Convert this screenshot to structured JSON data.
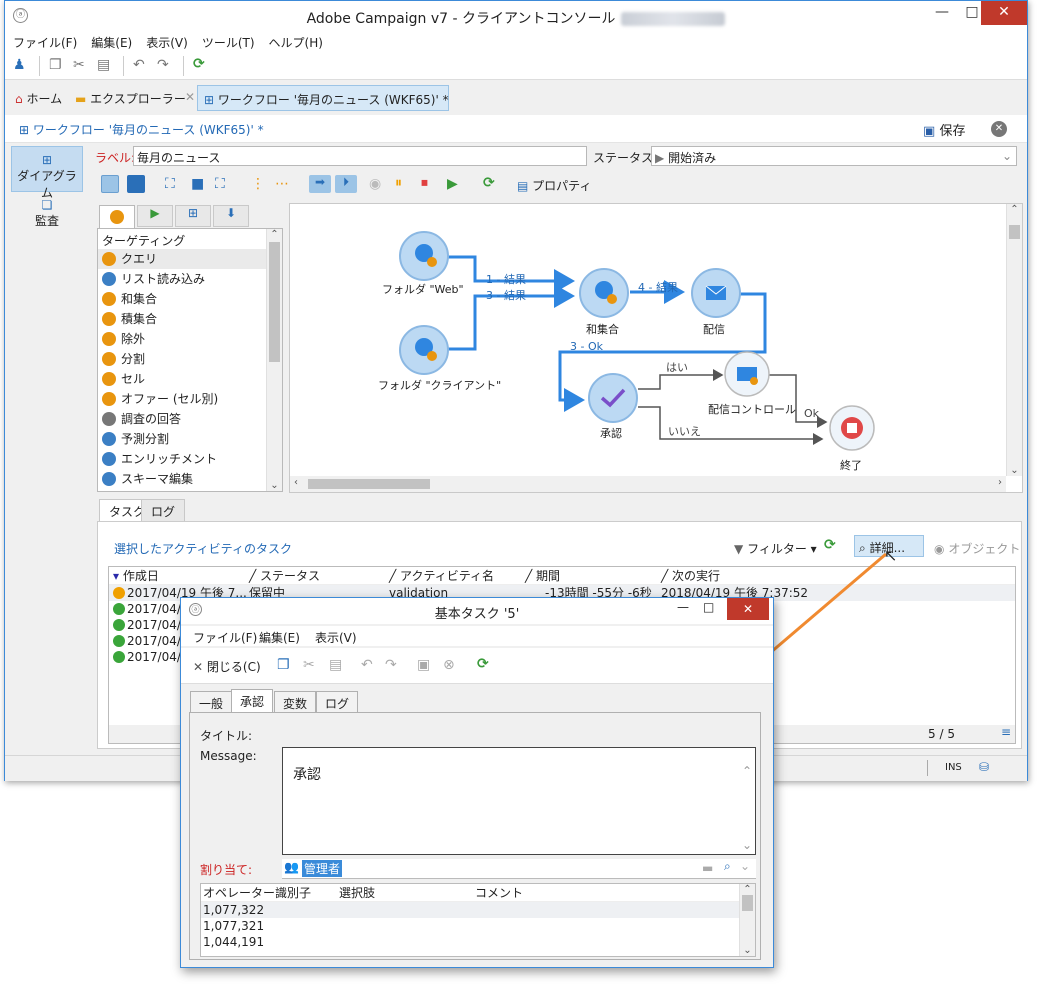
{
  "window": {
    "title": "Adobe Campaign v7 - クライアントコンソール",
    "blurred_user_label": "[admin@New]",
    "controls": {
      "minimize": "—",
      "maximize": "□",
      "close": "✕"
    }
  },
  "menu": [
    "ファイル(F)",
    "編集(E)",
    "表示(V)",
    "ツール(T)",
    "ヘルプ(H)"
  ],
  "tabs": {
    "home": "ホーム",
    "explorer": "エクスプローラー",
    "workflow": "ワークフロー '毎月のニュース (WKF65)'  *"
  },
  "subheader": {
    "breadcrumb": "ワークフロー '毎月のニュース (WKF65)' *",
    "save": "保存"
  },
  "sidebar": {
    "diagram": "ダイアグラム",
    "audit": "監査"
  },
  "form": {
    "label_caption": "ラベル:",
    "label_value": "毎月のニュース",
    "status_caption": "ステータス:",
    "status_value": "開始済み"
  },
  "canvas_toolbar": {
    "properties": "プロパティ"
  },
  "palette": {
    "header": "ターゲティング",
    "items": [
      {
        "label": "クエリ",
        "icon": "query-icon",
        "color": "#e8950f"
      },
      {
        "label": "リスト読み込み",
        "icon": "list-load-icon",
        "color": "#3b7fc4"
      },
      {
        "label": "和集合",
        "icon": "union-icon",
        "color": "#e8950f"
      },
      {
        "label": "積集合",
        "icon": "intersection-icon",
        "color": "#e8950f"
      },
      {
        "label": "除外",
        "icon": "exclusion-icon",
        "color": "#e8950f"
      },
      {
        "label": "分割",
        "icon": "split-icon",
        "color": "#e8950f"
      },
      {
        "label": "セル",
        "icon": "cell-icon",
        "color": "#e8950f"
      },
      {
        "label": "オファー (セル別)",
        "icon": "offer-icon",
        "color": "#e8950f"
      },
      {
        "label": "調査の回答",
        "icon": "survey-icon",
        "color": "#777777"
      },
      {
        "label": "予測分割",
        "icon": "prediction-icon",
        "color": "#3b7fc4"
      },
      {
        "label": "エンリッチメント",
        "icon": "enrichment-icon",
        "color": "#3b7fc4"
      },
      {
        "label": "スキーマ編集",
        "icon": "schema-icon",
        "color": "#3b7fc4"
      }
    ]
  },
  "workflow": {
    "nodes": {
      "folder_web": "フォルダ \"Web\"",
      "folder_client": "フォルダ \"クライアント\"",
      "union": "和集合",
      "delivery": "配信",
      "approval": "承認",
      "delivery_control": "配信コントロール",
      "end": "終了"
    },
    "transitions": {
      "t1": "1 - 結果",
      "t3": "3 - 結果",
      "t4": "4 - 結果",
      "t3ok": "3 - Ok",
      "yes": "はい",
      "no": "いいえ",
      "ok": "Ok"
    }
  },
  "lower_tabs": {
    "tasks": "タスク",
    "log": "ログ"
  },
  "tasks_panel": {
    "title": "選択したアクティビティのタスク",
    "filter": "フィルター",
    "detail": "詳細...",
    "object": "オブジェクト",
    "columns": [
      "作成日",
      "ステータス",
      "アクティビティ名",
      "期間",
      "次の実行"
    ],
    "rows": [
      {
        "created": "2017/04/19 午後 7...",
        "status": "保留中",
        "activity": "validation",
        "duration": "-13時間 -55分 -6秒",
        "next": "2018/04/19 午後 7:37:52",
        "icon": "pending-icon"
      },
      {
        "created": "2017/04/",
        "icon": "done-icon"
      },
      {
        "created": "2017/04/",
        "icon": "done-icon"
      },
      {
        "created": "2017/04/",
        "icon": "done-icon"
      },
      {
        "created": "2017/04/",
        "icon": "done-icon"
      }
    ],
    "counter": "5 / 5"
  },
  "statusbar": {
    "ins": "INS"
  },
  "dialog": {
    "title": "基本タスク '5'",
    "menu": [
      "ファイル(F)",
      "編集(E)",
      "表示(V)"
    ],
    "close_label": "閉じる(C)",
    "tabs": [
      "一般",
      "承認",
      "変数",
      "ログ"
    ],
    "title_caption": "タイトル:",
    "message_caption": "Message:",
    "message_value": "承認",
    "assign_caption": "割り当て:",
    "assign_value": "管理者",
    "grid_columns": [
      "オペレーター識別子",
      "選択肢",
      "コメント"
    ],
    "grid_rows": [
      "1,077,322",
      "1,077,321",
      "1,044,191"
    ]
  },
  "colors": {
    "accent": "#3a8bd9",
    "node_fill": "#bcd9f3",
    "arrow": "#2f86e0",
    "red": "#cc2222"
  }
}
